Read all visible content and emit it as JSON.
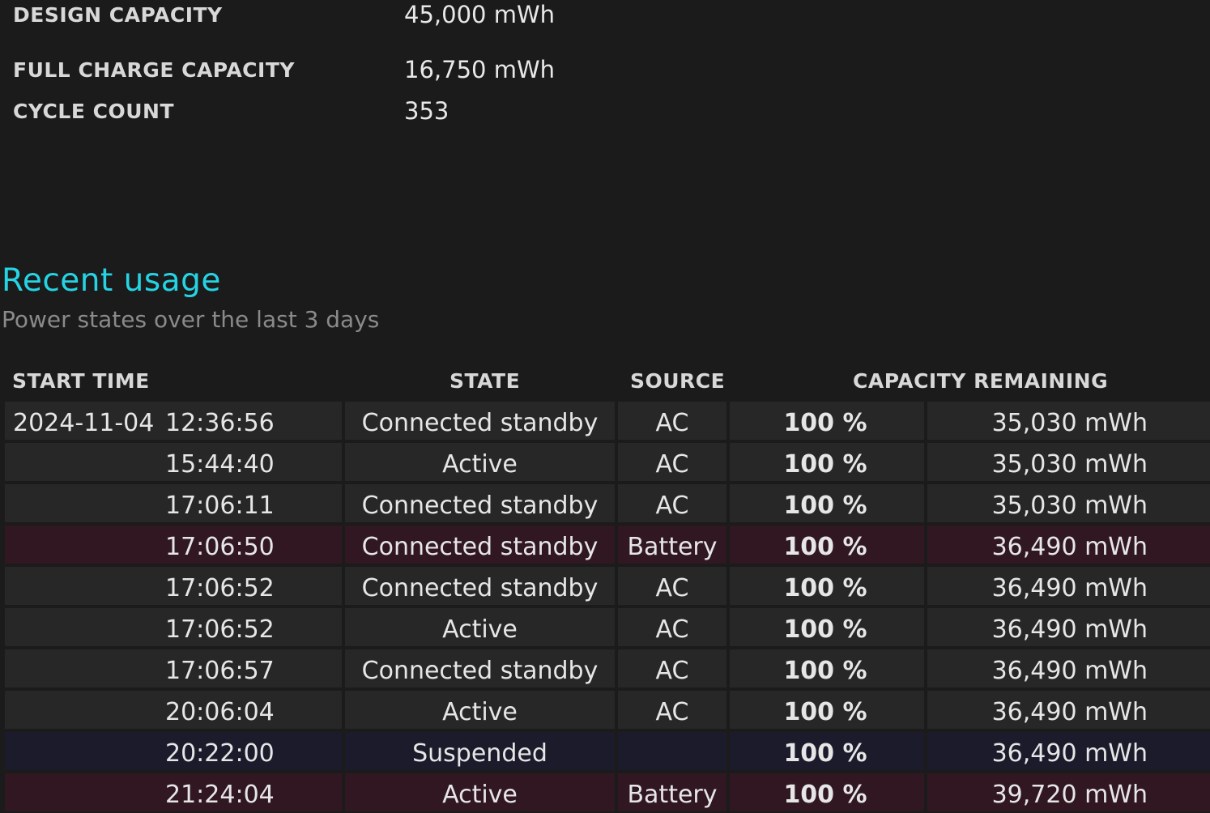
{
  "battery_info": [
    {
      "label": "DESIGN CAPACITY",
      "value": "45,000 mWh"
    },
    {
      "label": "FULL CHARGE CAPACITY",
      "value": "16,750 mWh"
    },
    {
      "label": "CYCLE COUNT",
      "value": "353"
    }
  ],
  "recent_usage": {
    "title": "Recent usage",
    "subtitle": "Power states over the last 3 days",
    "columns": {
      "start_time": "START TIME",
      "state": "STATE",
      "source": "SOURCE",
      "capacity_remaining": "CAPACITY REMAINING"
    },
    "rows": [
      {
        "date": "2024-11-04",
        "time": "12:36:56",
        "state": "Connected standby",
        "source": "AC",
        "percent": "100 %",
        "capacity": "35,030 mWh",
        "kind": "ac"
      },
      {
        "date": "",
        "time": "15:44:40",
        "state": "Active",
        "source": "AC",
        "percent": "100 %",
        "capacity": "35,030 mWh",
        "kind": "ac"
      },
      {
        "date": "",
        "time": "17:06:11",
        "state": "Connected standby",
        "source": "AC",
        "percent": "100 %",
        "capacity": "35,030 mWh",
        "kind": "ac"
      },
      {
        "date": "",
        "time": "17:06:50",
        "state": "Connected standby",
        "source": "Battery",
        "percent": "100 %",
        "capacity": "36,490 mWh",
        "kind": "battery"
      },
      {
        "date": "",
        "time": "17:06:52",
        "state": "Connected standby",
        "source": "AC",
        "percent": "100 %",
        "capacity": "36,490 mWh",
        "kind": "ac"
      },
      {
        "date": "",
        "time": "17:06:52",
        "state": "Active",
        "source": "AC",
        "percent": "100 %",
        "capacity": "36,490 mWh",
        "kind": "ac"
      },
      {
        "date": "",
        "time": "17:06:57",
        "state": "Connected standby",
        "source": "AC",
        "percent": "100 %",
        "capacity": "36,490 mWh",
        "kind": "ac"
      },
      {
        "date": "",
        "time": "20:06:04",
        "state": "Active",
        "source": "AC",
        "percent": "100 %",
        "capacity": "36,490 mWh",
        "kind": "ac"
      },
      {
        "date": "",
        "time": "20:22:00",
        "state": "Suspended",
        "source": "",
        "percent": "100 %",
        "capacity": "36,490 mWh",
        "kind": "suspended"
      },
      {
        "date": "",
        "time": "21:24:04",
        "state": "Active",
        "source": "Battery",
        "percent": "100 %",
        "capacity": "39,720 mWh",
        "kind": "battery"
      }
    ]
  },
  "colors": {
    "background": "#1b1b1b",
    "heading_accent": "#25d4e4",
    "row_ac": "#272727",
    "row_battery": "#311722",
    "row_suspended": "#1b1b2c"
  }
}
